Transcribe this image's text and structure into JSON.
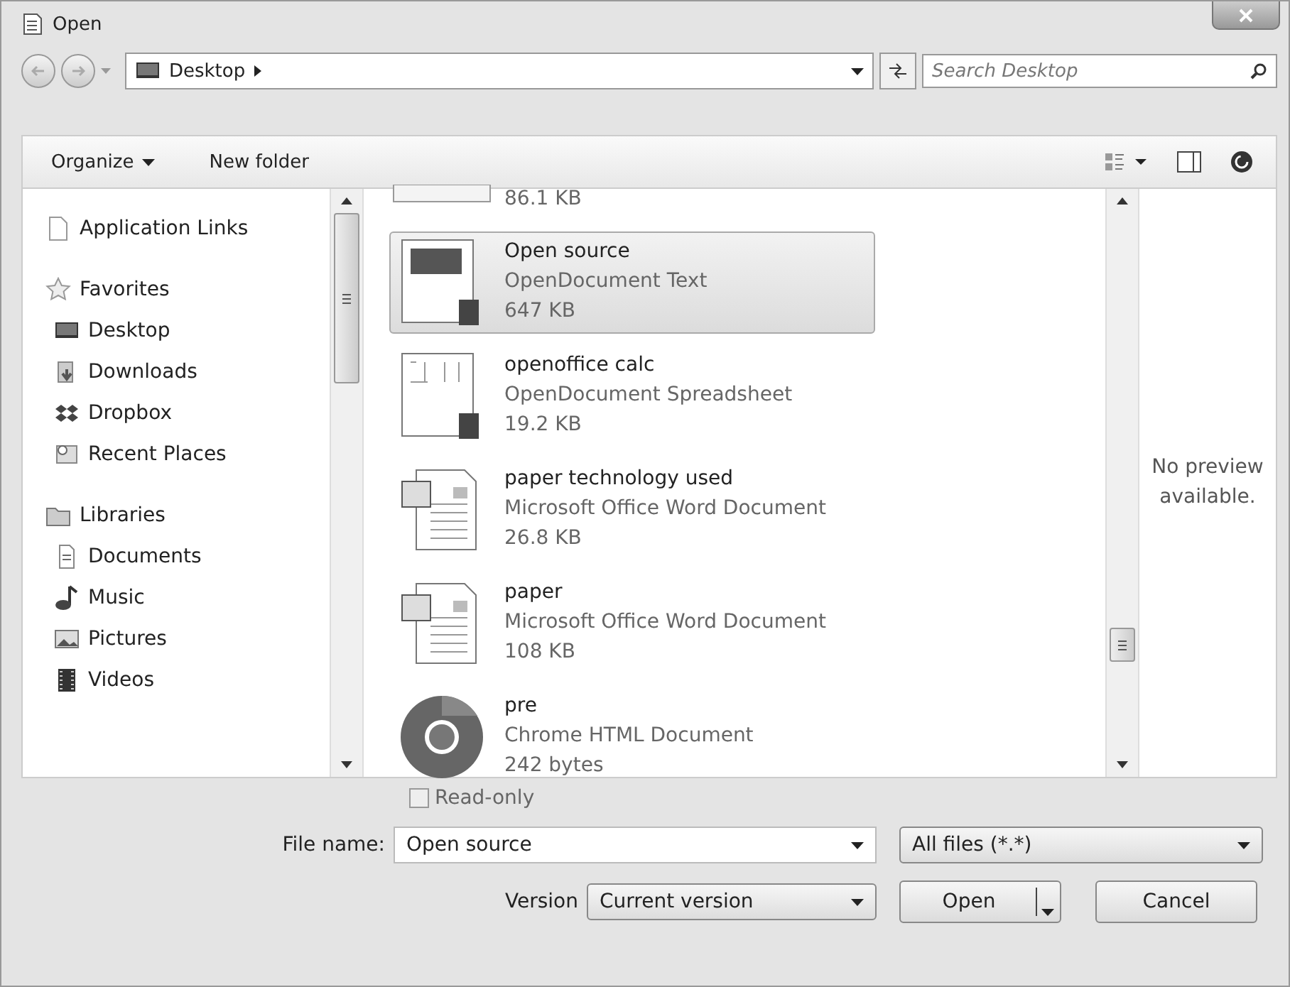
{
  "window": {
    "title": "Open"
  },
  "address": {
    "location": "Desktop"
  },
  "search": {
    "placeholder": "Search Desktop"
  },
  "toolbar": {
    "organize": "Organize",
    "new_folder": "New folder"
  },
  "nav": [
    {
      "label": "Application Links",
      "kind": "page"
    },
    {
      "label": "Favorites",
      "kind": "star",
      "children": [
        {
          "label": "Desktop",
          "kind": "desktop"
        },
        {
          "label": "Downloads",
          "kind": "downloads"
        },
        {
          "label": "Dropbox",
          "kind": "dropbox"
        },
        {
          "label": "Recent Places",
          "kind": "recent"
        }
      ]
    },
    {
      "label": "Libraries",
      "kind": "library",
      "children": [
        {
          "label": "Documents",
          "kind": "documents"
        },
        {
          "label": "Music",
          "kind": "music"
        },
        {
          "label": "Pictures",
          "kind": "pictures"
        },
        {
          "label": "Videos",
          "kind": "videos"
        }
      ]
    }
  ],
  "files": [
    {
      "kind": "partial",
      "size": "86.1 KB",
      "selected": false
    },
    {
      "kind": "odt",
      "name": "Open source",
      "type": "OpenDocument Text",
      "size": "647 KB",
      "selected": true
    },
    {
      "kind": "ods",
      "name": "openoffice calc",
      "type": "OpenDocument Spreadsheet",
      "size": "19.2 KB",
      "selected": false
    },
    {
      "kind": "doc",
      "name": "paper technology used",
      "type": "Microsoft Office Word Document",
      "size": "26.8 KB",
      "selected": false
    },
    {
      "kind": "doc",
      "name": "paper",
      "type": "Microsoft Office Word Document",
      "size": "108 KB",
      "selected": false
    },
    {
      "kind": "chrome",
      "name": "pre",
      "type": "Chrome HTML Document",
      "size": "242 bytes",
      "selected": false
    }
  ],
  "preview": {
    "message": "No preview available."
  },
  "read_only": {
    "label": "Read-only",
    "checked": false
  },
  "file_name": {
    "label": "File name:",
    "value": "Open source"
  },
  "file_type": {
    "value": "All files (*.*)"
  },
  "version": {
    "label": "Version",
    "value": "Current version"
  },
  "buttons": {
    "open": "Open",
    "cancel": "Cancel"
  }
}
